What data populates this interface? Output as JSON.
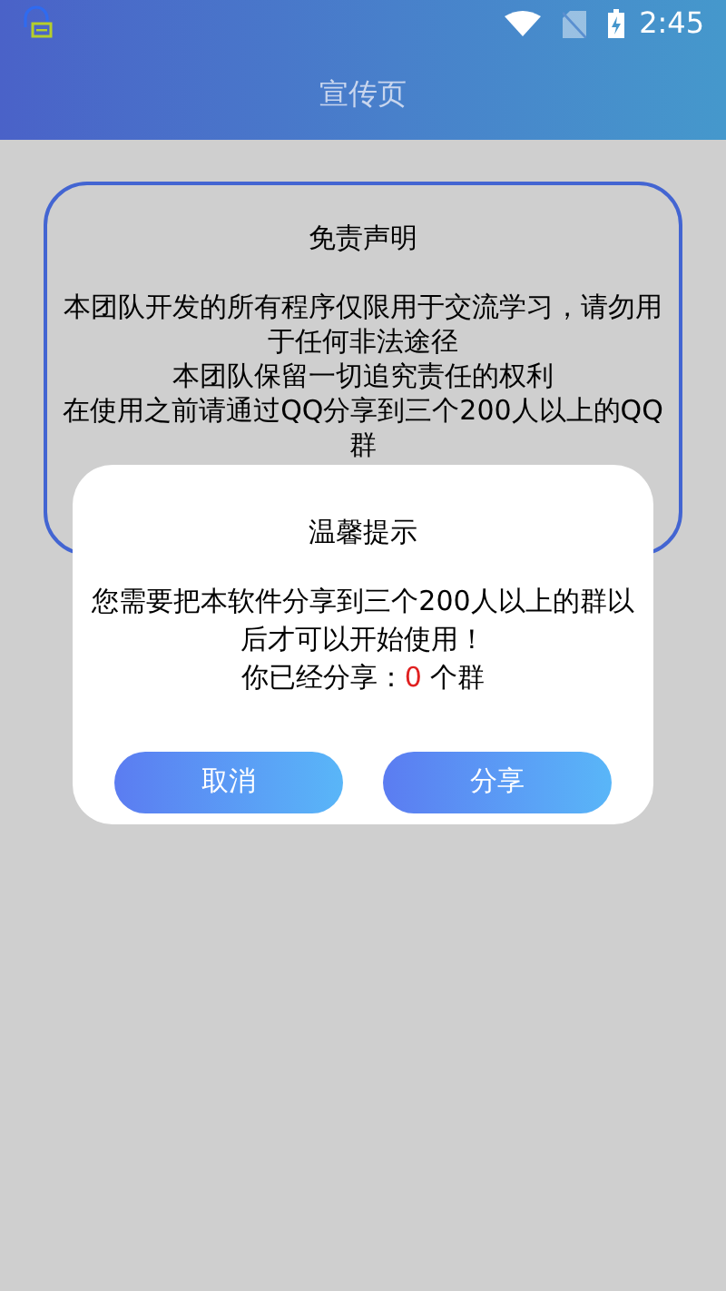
{
  "status_bar": {
    "time": "2:45"
  },
  "header": {
    "title": "宣传页"
  },
  "disclaimer": {
    "title": "免责声明",
    "lines": [
      "本团队开发的所有程序仅限用于交流学习，请勿用于任何非法途径",
      "本团队保留一切追究责任的权利",
      "在使用之前请通过QQ分享到三个200人以上的QQ群"
    ]
  },
  "dialog": {
    "title": "温馨提示",
    "message": "您需要把本软件分享到三个200人以上的群以后才可以开始使用！",
    "count_prefix": "你已经分享：",
    "count": "0",
    "count_suffix": " 个群",
    "buttons": [
      "取消",
      "分享"
    ]
  }
}
